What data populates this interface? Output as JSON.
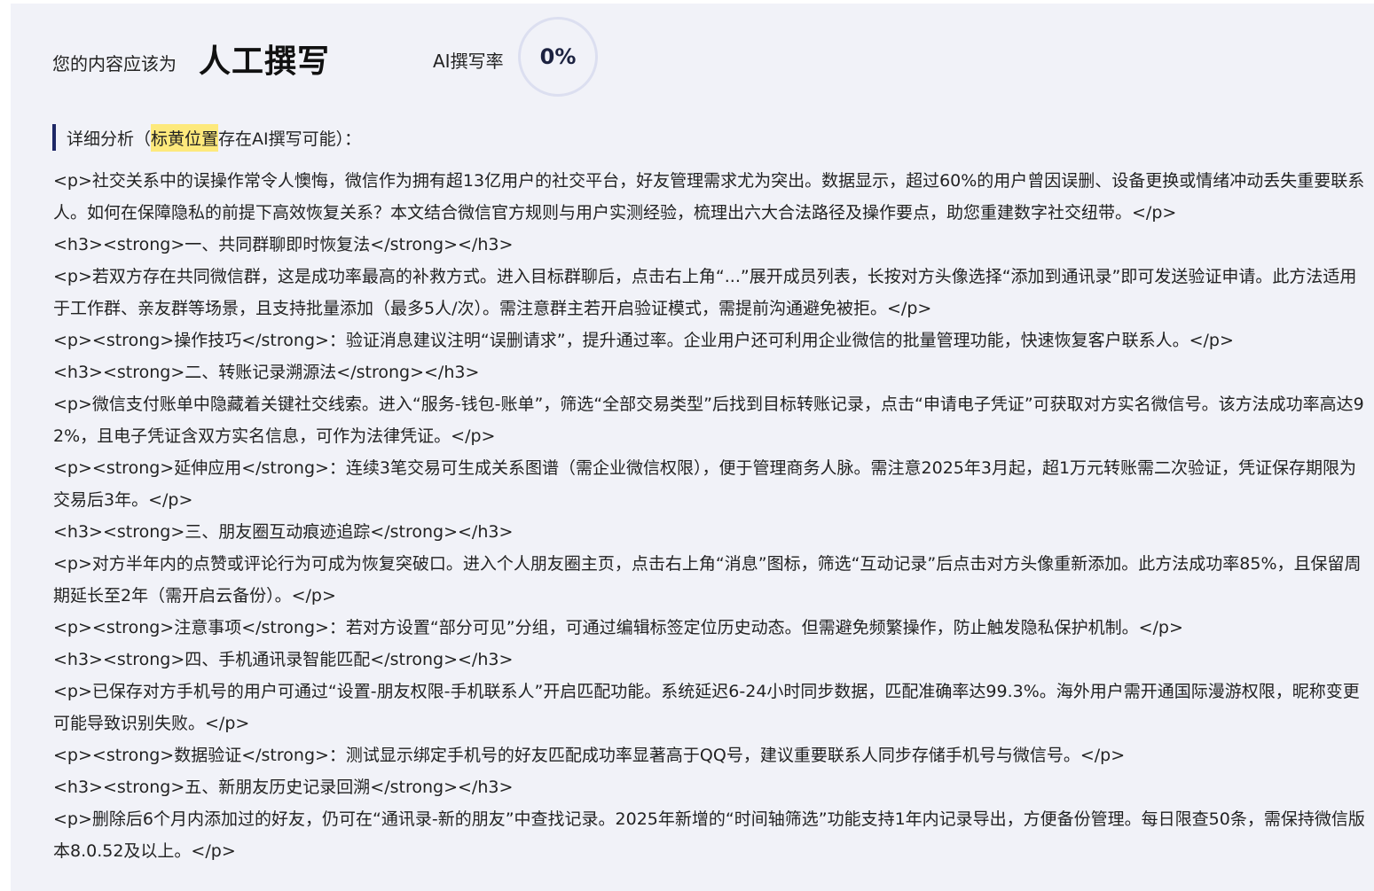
{
  "header": {
    "prefix": "您的内容应该为",
    "verdict": "人工撰写",
    "rate_label": "AI撰写率",
    "rate_value": "0%"
  },
  "analysis": {
    "title_pre": "详细分析（",
    "title_highlight": "标黄位置",
    "title_post": "存在AI撰写可能）："
  },
  "content": {
    "lines": [
      "<p>社交关系中的误操作常令人懊悔，微信作为拥有超13亿用户的社交平台，好友管理需求尤为突出。数据显示，超过60%的用户曾因误删、设备更换或情绪冲动丢失重要联系人。如何在保障隐私的前提下高效恢复关系？本文结合微信官方规则与用户实测经验，梳理出六大合法路径及操作要点，助您重建数字社交纽带。</p>",
      "<h3><strong>一、共同群聊即时恢复法</strong></h3>",
      "<p>若双方存在共同微信群，这是成功率最高的补救方式。进入目标群聊后，点击右上角“...”展开成员列表，长按对方头像选择“添加到通讯录”即可发送验证申请。此方法适用于工作群、亲友群等场景，且支持批量添加（最多5人/次）。需注意群主若开启验证模式，需提前沟通避免被拒。</p>",
      "<p><strong>操作技巧</strong>：验证消息建议注明“误删请求”，提升通过率。企业用户还可利用企业微信的批量管理功能，快速恢复客户联系人。</p>",
      "<h3><strong>二、转账记录溯源法</strong></h3>",
      "<p>微信支付账单中隐藏着关键社交线索。进入“服务-钱包-账单”，筛选“全部交易类型”后找到目标转账记录，点击“申请电子凭证”可获取对方实名微信号。该方法成功率高达92%，且电子凭证含双方实名信息，可作为法律凭证。</p>",
      "<p><strong>延伸应用</strong>：连续3笔交易可生成关系图谱（需企业微信权限），便于管理商务人脉。需注意2025年3月起，超1万元转账需二次验证，凭证保存期限为交易后3年。</p>",
      "<h3><strong>三、朋友圈互动痕迹追踪</strong></h3>",
      "<p>对方半年内的点赞或评论行为可成为恢复突破口。进入个人朋友圈主页，点击右上角“消息”图标，筛选“互动记录”后点击对方头像重新添加。此方法成功率85%，且保留周期延长至2年（需开启云备份）。</p>",
      "<p><strong>注意事项</strong>：若对方设置“部分可见”分组，可通过编辑标签定位历史动态。但需避免频繁操作，防止触发隐私保护机制。</p>",
      "<h3><strong>四、手机通讯录智能匹配</strong></h3>",
      "<p>已保存对方手机号的用户可通过“设置-朋友权限-手机联系人”开启匹配功能。系统延迟6-24小时同步数据，匹配准确率达99.3%。海外用户需开通国际漫游权限，昵称变更可能导致识别失败。</p>",
      "<p><strong>数据验证</strong>：测试显示绑定手机号的好友匹配成功率显著高于QQ号，建议重要联系人同步存储手机号与微信号。</p>",
      "<h3><strong>五、新朋友历史记录回溯</strong></h3>",
      "<p>删除后6个月内添加过的好友，仍可在“通讯录-新的朋友”中查找记录。2025年新增的“时间轴筛选”功能支持1年内记录导出，方便备份管理。每日限查50条，需保持微信版本8.0.52及以上。</p>"
    ]
  }
}
